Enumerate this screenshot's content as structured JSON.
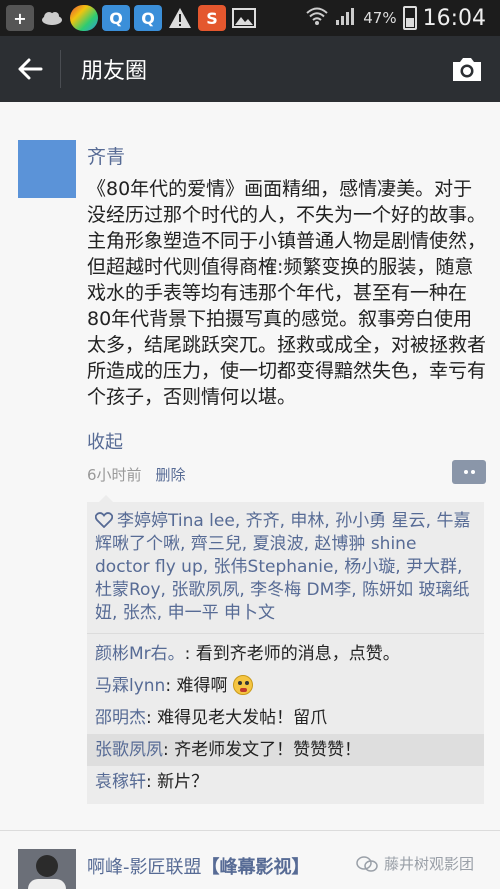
{
  "status_bar": {
    "icons": [
      "plus-icon",
      "cloud-icon",
      "color-app-icon",
      "qq-icon",
      "qq-icon",
      "warning-icon",
      "s-app-icon",
      "image-icon"
    ],
    "battery": "47%",
    "time": "16:04"
  },
  "header": {
    "title": "朋友圈"
  },
  "post": {
    "author": "齐青",
    "content": "《80年代的爱情》画面精细，感情凄美。对于没经历过那个时代的人，不失为一个好的故事。主角形象塑造不同于小镇普通人物是剧情使然，但超越时代则值得商榷:频繁变换的服装，随意戏水的手表等均有违那个年代，甚至有一种在80年代背景下拍摄写真的感觉。叙事旁白使用太多，结尾跳跃突兀。拯救或成全，对被拯救者所造成的压力，使一切都变得黯然失色，幸亏有个孩子，否则情何以堪。",
    "collapse_label": "收起",
    "time": "6小时前",
    "delete_label": "删除",
    "likes": "李婷婷Tina lee, 齐齐, 申林, 孙小勇  星云, 牛嘉辉啾了个啾, 齊三兒, 夏浪波, 赵博翀 shine doctor fly up, 张伟Stephanie, 杨小璇, 尹大群, 杜蒙Roy, 张歌夙夙, 李冬梅 DM李, 陈妍如  玻璃纸妞, 张杰, 申一平 申卜文",
    "comments": [
      {
        "name": "颜彬Mr右。",
        "text": ": 看到齐老师的消息，点赞。"
      },
      {
        "name": "马霖lynn",
        "text": ": 难得啊"
      },
      {
        "name": "邵明杰",
        "text": ": 难得见老大发帖！留爪"
      },
      {
        "name": "张歌夙夙",
        "text": ": 齐老师发文了！赞赞赞！"
      },
      {
        "name": "袁稼轩",
        "text": ": 新片？"
      }
    ]
  },
  "next_post": {
    "author": "啊峰-影匠联盟",
    "author_tag": "【峰幕影视】",
    "watermark": "藤井树观影团"
  },
  "colors": {
    "link": "#576b95",
    "titlebar": "#2c2f33",
    "statusbar": "#1c1c1c"
  }
}
